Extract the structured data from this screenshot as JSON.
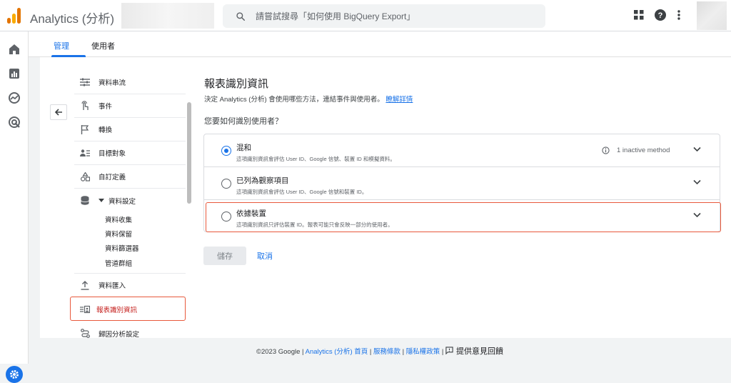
{
  "header": {
    "app_title": "Analytics (分析)",
    "search_placeholder": "請嘗試搜尋「如何使用 BigQuery Export」"
  },
  "tabs": [
    {
      "label": "管理",
      "active": true
    },
    {
      "label": "使用者",
      "active": false
    }
  ],
  "nav": {
    "items": [
      {
        "label": "資料串流",
        "icon": "streams-icon"
      },
      {
        "label": "事件",
        "icon": "touch-icon"
      },
      {
        "label": "轉換",
        "icon": "flag-icon"
      },
      {
        "label": "目標對象",
        "icon": "audience-icon"
      },
      {
        "label": "自訂定義",
        "icon": "shapes-icon"
      },
      {
        "label": "資料設定",
        "icon": "database-icon"
      }
    ],
    "data_settings_children": [
      "資料收集",
      "資料保留",
      "資料篩選器",
      "管道群組"
    ],
    "import_label": "資料匯入",
    "reporting_identity_label": "報表識別資訊",
    "attribution_label": "歸因分析設定"
  },
  "main": {
    "title": "報表識別資訊",
    "description": "決定 Analytics (分析) 會使用哪些方法，連結事件與使用者。",
    "learn_more": "瞭解詳情",
    "question": "您要如何識別使用者？",
    "options": [
      {
        "title": "混和",
        "subtitle": "這項識別資訊會評估 User ID、Google 信號、裝置 ID 和模擬資料。",
        "selected": true,
        "info": "1 inactive method"
      },
      {
        "title": "已列為觀察項目",
        "subtitle": "這項識別資訊會評估 User ID、Google 信號和裝置 ID。",
        "selected": false
      },
      {
        "title": "依據裝置",
        "subtitle": "這項識別資訊只評估裝置 ID。報表可能只會反映一部分的使用者。",
        "selected": false
      }
    ],
    "save_label": "儲存",
    "cancel_label": "取消"
  },
  "footer": {
    "copyright": "©2023 Google",
    "sep": " | ",
    "home": "Analytics (分析) 首頁",
    "terms": "服務條款",
    "privacy": "隱私權政策",
    "feedback": "提供意見回饋"
  },
  "colors": {
    "accent": "#1a73e8",
    "highlight": "#e8593c"
  }
}
